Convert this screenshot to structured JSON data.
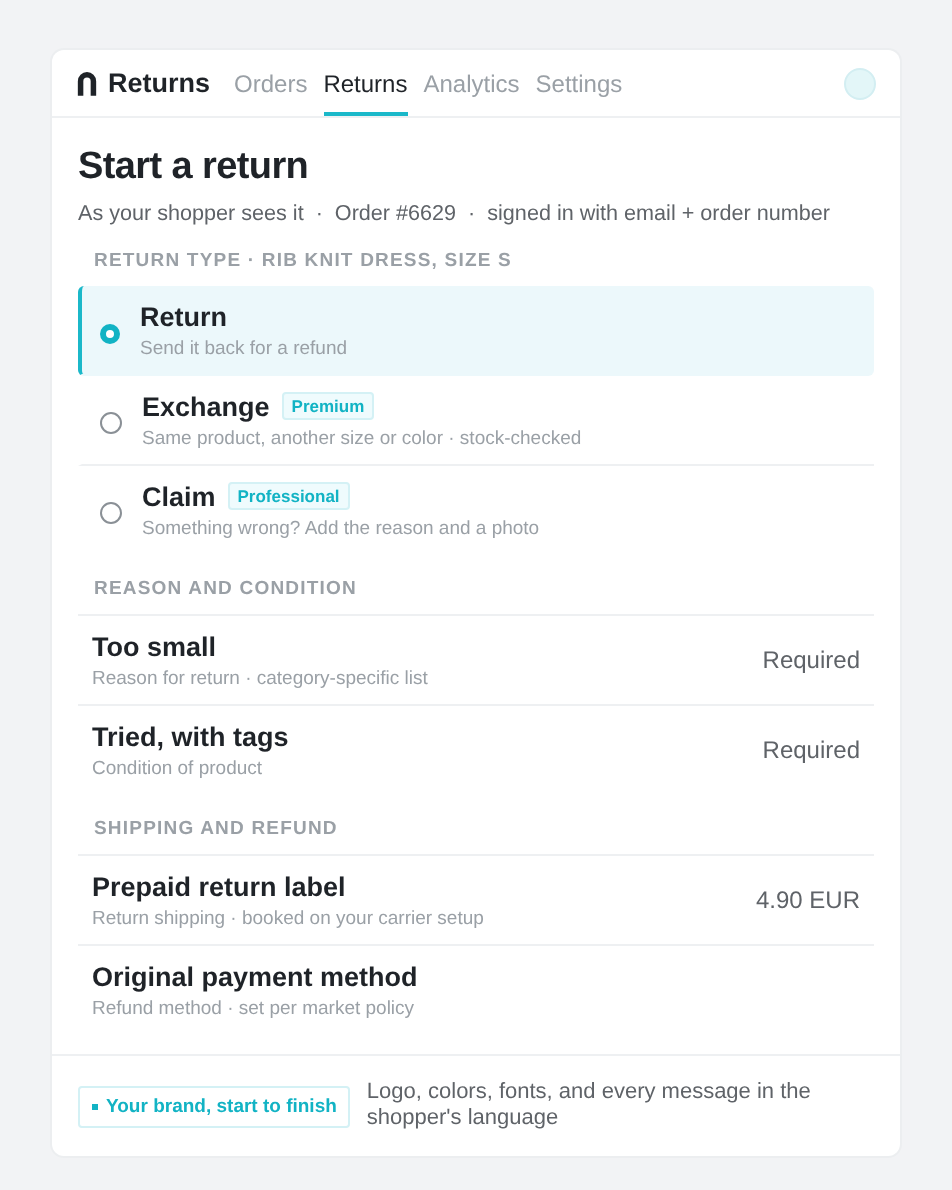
{
  "header": {
    "brand": "Returns",
    "tabs": [
      {
        "label": "Orders",
        "selected": false
      },
      {
        "label": "Returns",
        "selected": true
      },
      {
        "label": "Analytics",
        "selected": false
      },
      {
        "label": "Settings",
        "selected": false
      }
    ]
  },
  "title": "Start a return",
  "subtitle": "As your shopper sees it  ·  Order #6629  ·  signed in with email + order number",
  "sections": [
    {
      "heading": "RETURN TYPE · RIB KNIT DRESS, SIZE S",
      "kind": "options",
      "items": [
        {
          "title": "Return",
          "description": "Send it back for a refund",
          "selected": true
        },
        {
          "title": "Exchange",
          "badge": "Premium",
          "description": "Same product, another size or color · stock-checked",
          "selected": false
        },
        {
          "title": "Claim",
          "badge": "Professional",
          "description": "Something wrong? Add the reason and a photo",
          "selected": false
        }
      ]
    },
    {
      "heading": "REASON AND CONDITION",
      "kind": "rows",
      "items": [
        {
          "title": "Too small",
          "description": "Reason for return · category-specific list",
          "value": "Required"
        },
        {
          "title": "Tried, with tags",
          "description": "Condition of product",
          "value": "Required"
        }
      ]
    },
    {
      "heading": "SHIPPING AND REFUND",
      "kind": "rows",
      "items": [
        {
          "title": "Prepaid return label",
          "description": "Return shipping · booked on your carrier setup",
          "value": "4.90 EUR"
        },
        {
          "title": "Original payment method",
          "description": "Refund method · set per market policy"
        }
      ]
    }
  ],
  "footer": {
    "tag": "Your brand, start to finish",
    "text": "Logo, colors, fonts, and every message in the shopper's language"
  }
}
